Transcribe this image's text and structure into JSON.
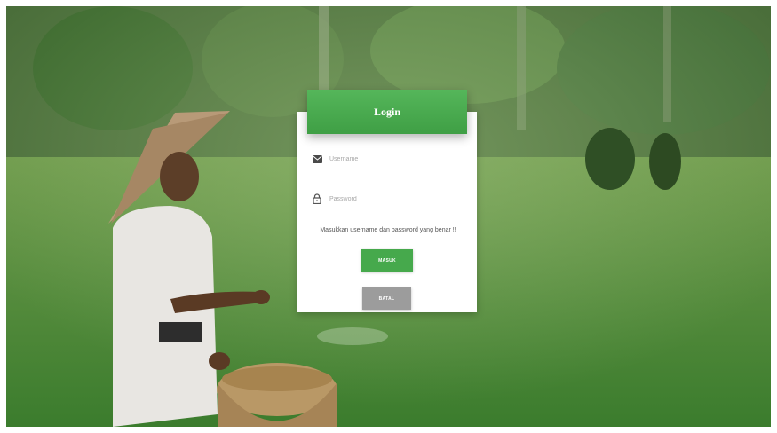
{
  "login": {
    "title": "Login",
    "username_placeholder": "Username",
    "password_placeholder": "Password",
    "message": "Masukkan username dan password yang benar !!",
    "submit_label": "MASUK",
    "cancel_label": "BATAL"
  },
  "icons": {
    "username": "envelope-icon",
    "password": "lock-icon"
  },
  "colors": {
    "accent": "#46a94c",
    "cancel": "#9c9c9c"
  }
}
